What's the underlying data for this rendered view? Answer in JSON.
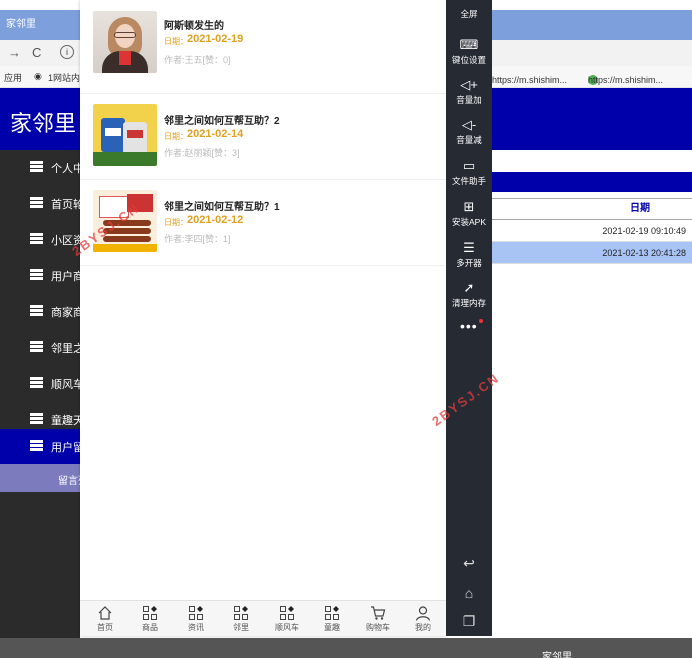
{
  "background_window": {
    "title": "家邻里",
    "nav": {
      "back": "→",
      "reload": "C",
      "info": "i"
    },
    "bookmarks": {
      "apps": "应用",
      "site": "1网站内"
    },
    "bookmarks_right": [
      {
        "label": "https://m.shishim..."
      },
      {
        "label": "https://m.shishim..."
      }
    ],
    "site_title": "家邻里",
    "sidebar": [
      {
        "label": "个人中心"
      },
      {
        "label": "首页轮播"
      },
      {
        "label": "小区资讯"
      },
      {
        "label": "用户商品"
      },
      {
        "label": "商家商品"
      },
      {
        "label": "邻里之间"
      },
      {
        "label": "顺风车"
      },
      {
        "label": "童趣天地"
      },
      {
        "label": "用户留言"
      }
    ],
    "sidebar_sub": "留言列表",
    "table": {
      "header_date": "日期",
      "rows": [
        {
          "date": "2021-02-19 09:10:49"
        },
        {
          "date": "2021-02-13 20:41:28"
        }
      ]
    },
    "footer": "家邻里"
  },
  "phone": {
    "items": [
      {
        "title": "阿斯顿发生的",
        "date_label": "日期：",
        "date": "2021-02-19",
        "author": "作者:王五[赞：0]",
        "image": "woman-portrait"
      },
      {
        "title": "邻里之间如何互帮互助？2",
        "date_label": "日期：",
        "date": "2021-02-14",
        "author": "作者:赵丽颖[赞：3]",
        "image": "engine-oil"
      },
      {
        "title": "邻里之间如何互帮互助？1",
        "date_label": "日期：",
        "date": "2021-02-12",
        "author": "作者:李四[赞：1]",
        "image": "food-snack"
      }
    ],
    "tabs": [
      {
        "label": "首页",
        "icon": "home-icon"
      },
      {
        "label": "商品",
        "icon": "grid-icon"
      },
      {
        "label": "资讯",
        "icon": "grid-icon"
      },
      {
        "label": "邻里",
        "icon": "grid-icon"
      },
      {
        "label": "顺风车",
        "icon": "grid-icon"
      },
      {
        "label": "童趣",
        "icon": "grid-icon"
      },
      {
        "label": "购物车",
        "icon": "cart-icon"
      },
      {
        "label": "我的",
        "icon": "user-icon"
      }
    ]
  },
  "toolbar": {
    "items": [
      {
        "label": "全屏",
        "icon": "fullscreen-icon"
      },
      {
        "label": "键位设置",
        "icon": "keyboard-icon"
      },
      {
        "label": "音量加",
        "icon": "volume-up-icon"
      },
      {
        "label": "音量减",
        "icon": "volume-down-icon"
      },
      {
        "label": "文件助手",
        "icon": "monitor-icon"
      },
      {
        "label": "安装APK",
        "icon": "install-icon"
      },
      {
        "label": "多开器",
        "icon": "multi-instance-icon"
      },
      {
        "label": "清理内存",
        "icon": "rocket-icon"
      }
    ],
    "more": "•••",
    "system": [
      {
        "icon": "back-icon"
      },
      {
        "icon": "home-icon"
      },
      {
        "icon": "recent-apps-icon"
      }
    ]
  },
  "watermark": "2BYSJ.CN",
  "colors": {
    "accent_blue": "#0000aa",
    "date_orange": "#e0a020",
    "toolbar_bg": "#252a33",
    "sidebar_bg": "#2b2b2b"
  }
}
